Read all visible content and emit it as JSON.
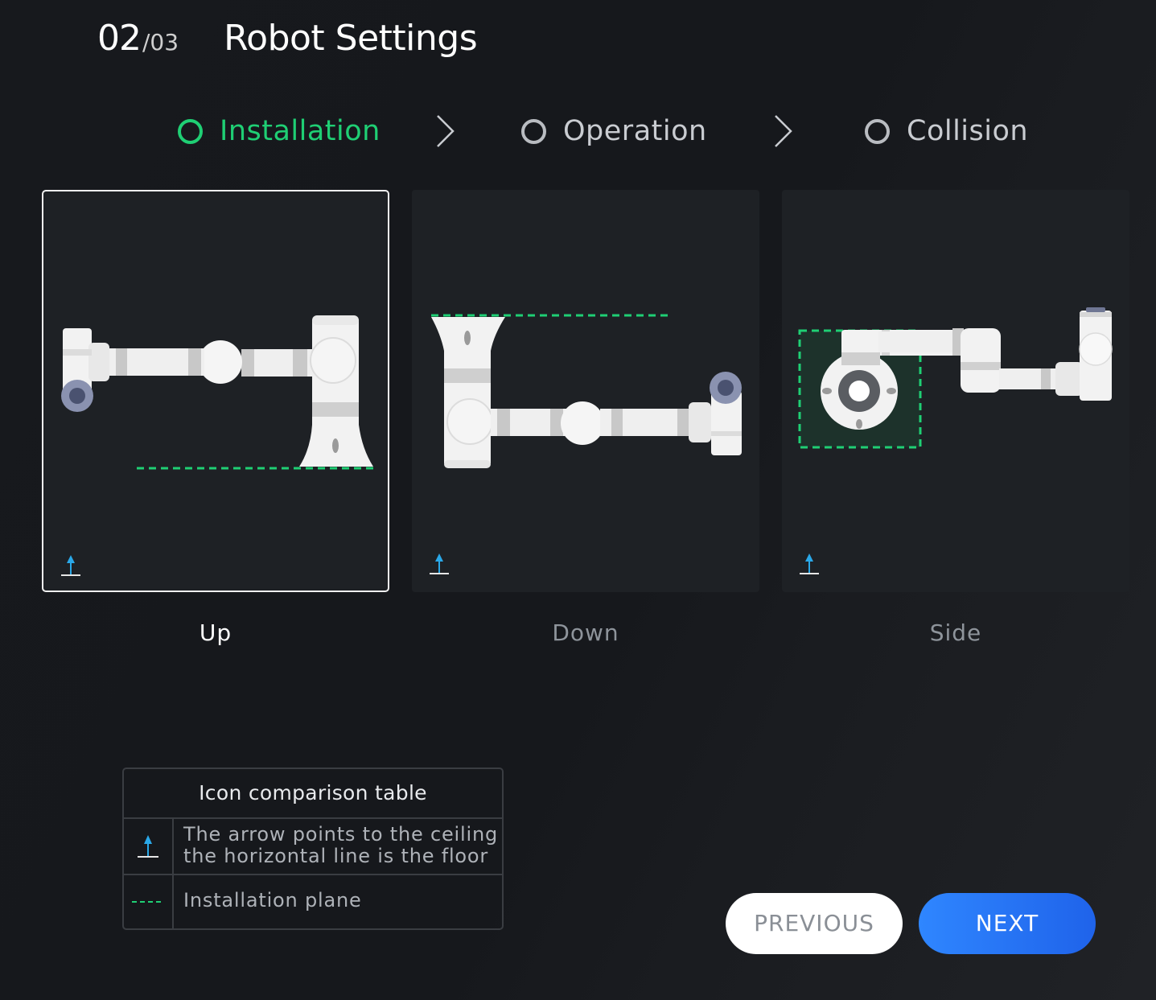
{
  "header": {
    "step_current": "02",
    "step_total": "/03",
    "title": "Robot Settings"
  },
  "stepper": [
    {
      "label": "Installation",
      "state": "active"
    },
    {
      "label": "Operation",
      "state": "pending"
    },
    {
      "label": "Collision",
      "state": "pending"
    }
  ],
  "cards": [
    {
      "label": "Up",
      "selected": true
    },
    {
      "label": "Down",
      "selected": false
    },
    {
      "label": "Side",
      "selected": false
    }
  ],
  "legend": {
    "title": "Icon comparison table",
    "rows": [
      {
        "icon": "floor-arrow-icon",
        "text_line1": "The arrow points to the ceiling",
        "text_line2": "the horizontal line is the floor"
      },
      {
        "icon": "dashed-line-icon",
        "text": "Installation plane"
      }
    ]
  },
  "buttons": {
    "previous": "PREVIOUS",
    "next": "NEXT"
  },
  "colors": {
    "active": "#1fcf74",
    "accent_blue": "#2f86ff",
    "arrow_icon": "#2aa8e8",
    "plane_line": "#1fcf74"
  }
}
